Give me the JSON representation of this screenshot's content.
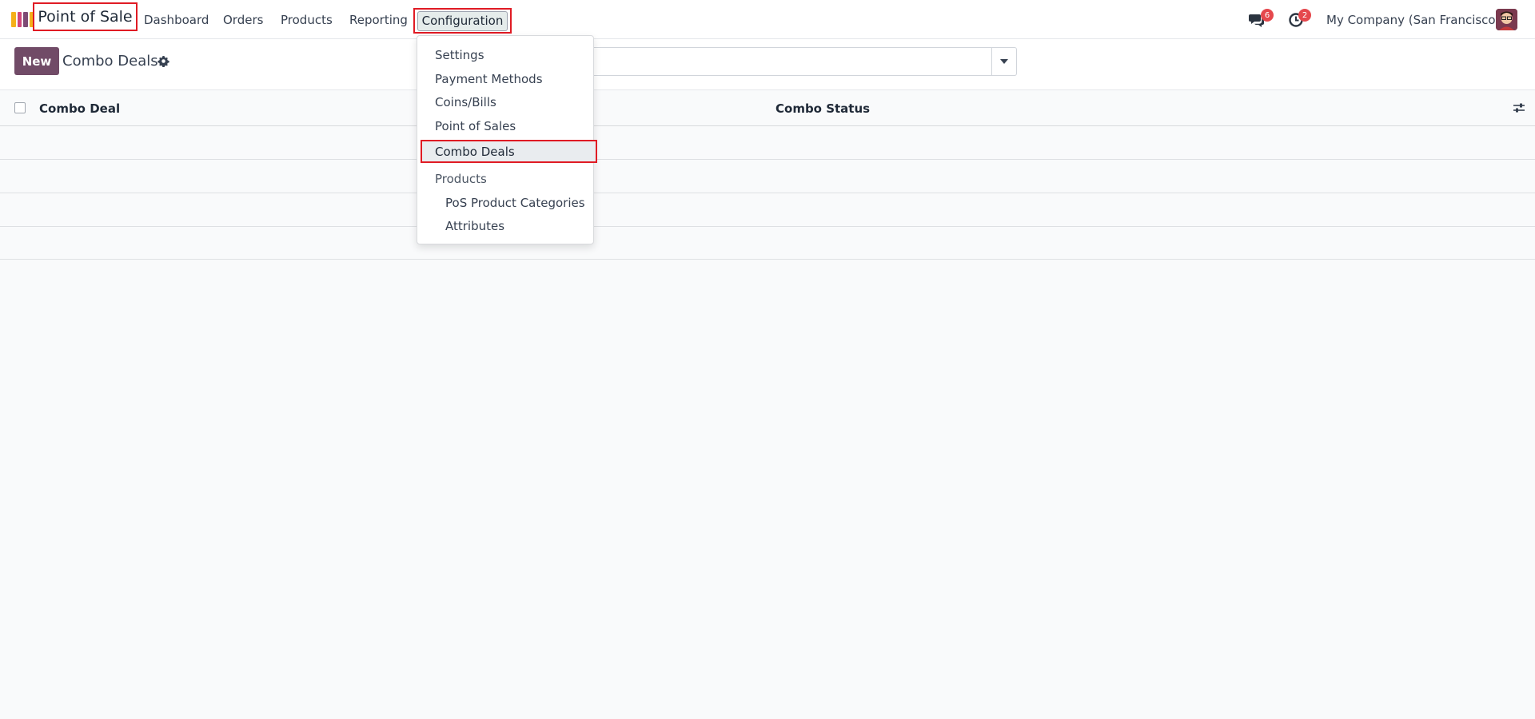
{
  "navbar": {
    "app_name": "Point of Sale",
    "menu": [
      "Dashboard",
      "Orders",
      "Products",
      "Reporting",
      "Configuration"
    ],
    "messages_count": "6",
    "activities_count": "2",
    "company": "My Company (San Francisco)"
  },
  "control_panel": {
    "new_label": "New",
    "title": "Combo Deals"
  },
  "list": {
    "columns": [
      "Combo Deal",
      "Combo Status"
    ]
  },
  "dropdown": {
    "items": [
      "Settings",
      "Payment Methods",
      "Coins/Bills",
      "Point of Sales",
      "Combo Deals"
    ],
    "section_header": "Products",
    "sub_items": [
      "PoS Product Categories",
      "Attributes"
    ]
  },
  "colors": {
    "brand": "#714b67",
    "highlight_border": "#e01b24",
    "badge": "#e5484d"
  }
}
